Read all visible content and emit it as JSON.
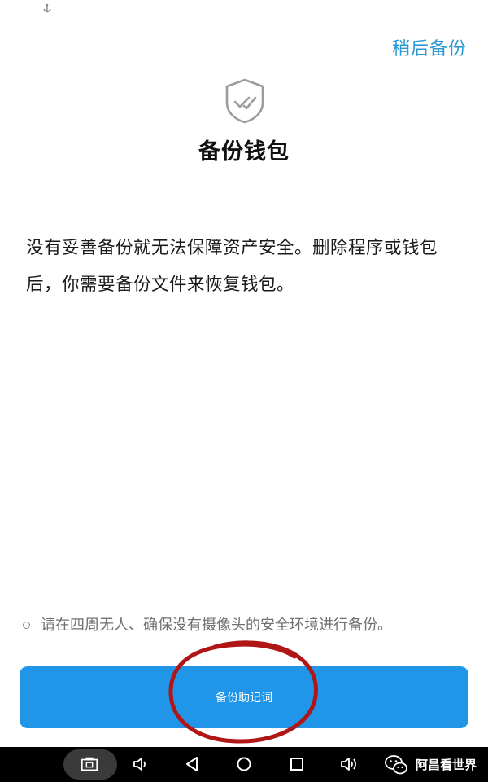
{
  "header": {
    "skip_label": "稍后备份"
  },
  "page": {
    "title": "备份钱包",
    "description": "没有妥善备份就无法保障资产安全。删除程序或钱包后，你需要备份文件来恢复钱包。",
    "icon": "shield-check-icon"
  },
  "tip": {
    "text": "请在四周无人、确保没有摄像头的安全环境进行备份。"
  },
  "primary_button": {
    "label": "备份助记词",
    "color": "#2196e8"
  },
  "annotation": {
    "color": "#b01616"
  },
  "navbar": {
    "icons": [
      "screenshot-icon",
      "volume-down-icon",
      "back-icon",
      "home-icon",
      "recents-icon",
      "volume-up-icon"
    ]
  },
  "watermark": {
    "text": "阿昌看世界"
  },
  "colors": {
    "accent": "#2b98d6",
    "text": "#1a1a1a",
    "muted": "#707070"
  }
}
